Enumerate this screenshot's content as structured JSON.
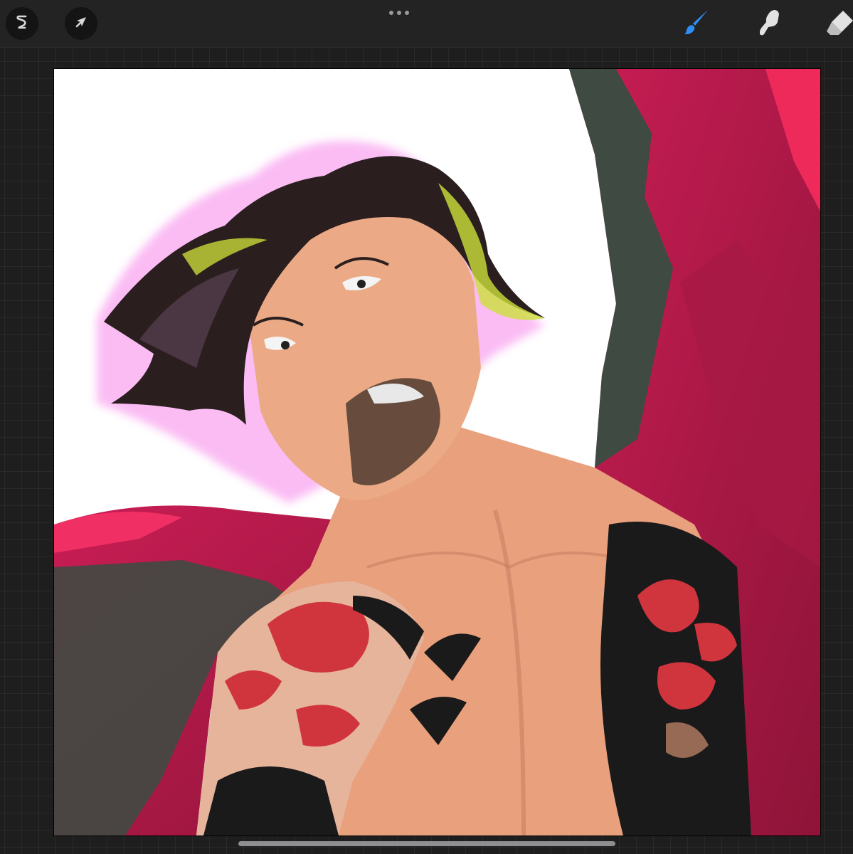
{
  "toolbar": {
    "left_tools": [
      {
        "id": "adjustments",
        "icon": "magic-wand-s-icon"
      },
      {
        "id": "transform",
        "icon": "arrow-cursor-icon"
      }
    ],
    "center": {
      "icon": "more-dots-icon"
    },
    "right_tools": [
      {
        "id": "brush",
        "icon": "brush-icon",
        "active": true
      },
      {
        "id": "smudge",
        "icon": "smudge-finger-icon",
        "active": false
      },
      {
        "id": "eraser",
        "icon": "eraser-icon",
        "active": false
      }
    ]
  },
  "colors": {
    "toolbar_bg": "#232324",
    "active_tool": "#2f8ff6",
    "inactive_tool": "#e2e2e2",
    "canvas_bg": "#ffffff",
    "robe_red": "#c3174f",
    "robe_shadow": "#3f4a42",
    "skin": "#e9a07c",
    "hair": "#2a1e1e",
    "tattoo_red": "#d0353e",
    "tattoo_black": "#1a1a1a"
  },
  "canvas": {
    "artwork": "digital-illustration-in-progress"
  }
}
